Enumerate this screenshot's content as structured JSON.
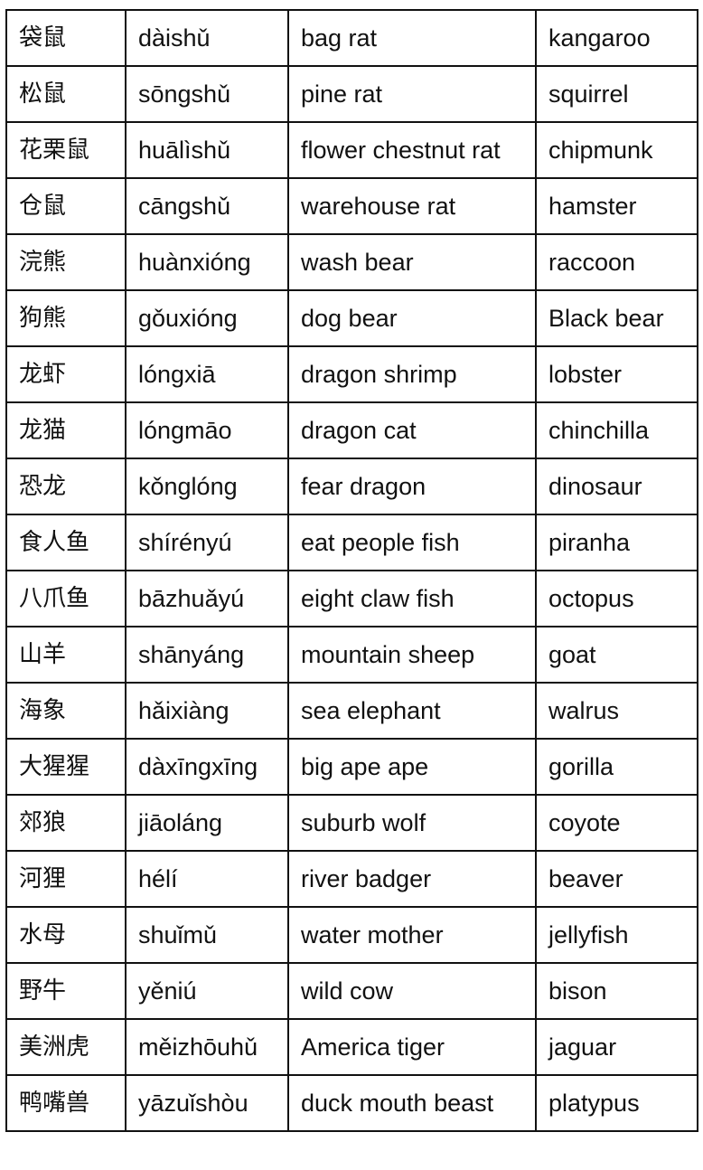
{
  "rows": [
    {
      "hanzi": "袋鼠",
      "pinyin": "dàishǔ",
      "literal": "bag rat",
      "english": "kangaroo"
    },
    {
      "hanzi": "松鼠",
      "pinyin": "sōngshǔ",
      "literal": "pine rat",
      "english": "squirrel"
    },
    {
      "hanzi": "花栗鼠",
      "pinyin": "huālìshǔ",
      "literal": "flower chestnut rat",
      "english": "chipmunk"
    },
    {
      "hanzi": "仓鼠",
      "pinyin": "cāngshǔ",
      "literal": "warehouse rat",
      "english": "hamster"
    },
    {
      "hanzi": "浣熊",
      "pinyin": "huànxióng",
      "literal": "wash bear",
      "english": "raccoon"
    },
    {
      "hanzi": "狗熊",
      "pinyin": "gǒuxióng",
      "literal": "dog bear",
      "english": "Black bear"
    },
    {
      "hanzi": "龙虾",
      "pinyin": "lóngxiā",
      "literal": "dragon shrimp",
      "english": "lobster"
    },
    {
      "hanzi": "龙猫",
      "pinyin": "lóngmāo",
      "literal": "dragon cat",
      "english": "chinchilla"
    },
    {
      "hanzi": "恐龙",
      "pinyin": "kǒnglóng",
      "literal": "fear dragon",
      "english": "dinosaur"
    },
    {
      "hanzi": "食人鱼",
      "pinyin": "shírényú",
      "literal": "eat people fish",
      "english": "piranha"
    },
    {
      "hanzi": "八爪鱼",
      "pinyin": "bāzhuǎyú",
      "literal": "eight claw fish",
      "english": "octopus"
    },
    {
      "hanzi": "山羊",
      "pinyin": "shānyáng",
      "literal": "mountain sheep",
      "english": "goat"
    },
    {
      "hanzi": "海象",
      "pinyin": "hǎixiàng",
      "literal": "sea elephant",
      "english": "walrus"
    },
    {
      "hanzi": "大猩猩",
      "pinyin": "dàxīngxīng",
      "literal": "big ape ape",
      "english": "gorilla"
    },
    {
      "hanzi": "郊狼",
      "pinyin": "jiāoláng",
      "literal": "suburb wolf",
      "english": "coyote"
    },
    {
      "hanzi": "河狸",
      "pinyin": "hélí",
      "literal": "river badger",
      "english": "beaver"
    },
    {
      "hanzi": "水母",
      "pinyin": "shuǐmǔ",
      "literal": "water mother",
      "english": "jellyfish"
    },
    {
      "hanzi": "野牛",
      "pinyin": "yěniú",
      "literal": "wild cow",
      "english": "bison"
    },
    {
      "hanzi": "美洲虎",
      "pinyin": "měizhōuhǔ",
      "literal": "America tiger",
      "english": "jaguar"
    },
    {
      "hanzi": "鸭嘴兽",
      "pinyin": "yāzuǐshòu",
      "literal": "duck mouth beast",
      "english": "platypus"
    }
  ]
}
